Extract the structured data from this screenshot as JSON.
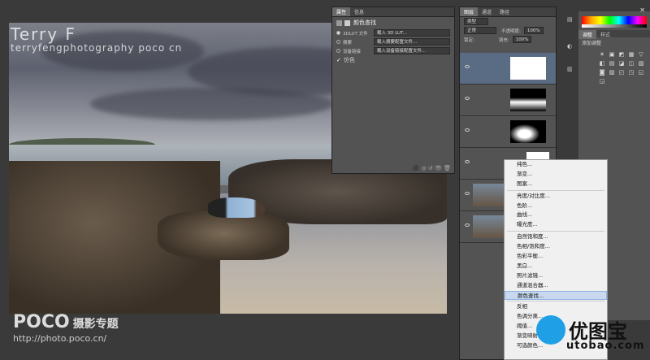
{
  "watermark": {
    "name": "Terry  F",
    "site": "terryfengphotography poco cn"
  },
  "logo": {
    "brand": "POCO",
    "sub": "摄影专题",
    "url": "http://photo.poco.cn/"
  },
  "props_panel": {
    "tabs": [
      "属性",
      "信息"
    ],
    "title": "颜色查找",
    "rows": [
      {
        "label": "3DLUT 文件",
        "value": "载入 3D LUT...",
        "selected": true
      },
      {
        "label": "摘要",
        "value": "载入摘要配置文件...",
        "selected": false
      },
      {
        "label": "设备链接",
        "value": "载入设备链接配置文件...",
        "selected": false
      }
    ],
    "dither_label": "仿色"
  },
  "layers_panel": {
    "tabs": [
      "图层",
      "通道",
      "路径"
    ],
    "kind": "类型",
    "blend": "正常",
    "opacity_label": "不透明度:",
    "opacity": "100%",
    "lock_label": "锁定:",
    "fill_label": "填充:",
    "fill": "100%"
  },
  "right_panel": {
    "tabs": [
      "调整",
      "样式"
    ],
    "title": "添加调整",
    "icons": [
      "☀",
      "▣",
      "◩",
      "▦",
      "▽",
      "◧",
      "▤",
      "◪",
      "◫",
      "▧",
      "◙",
      "▨",
      "◰",
      "◳",
      "◱",
      "◲"
    ]
  },
  "context_menu": {
    "items": [
      {
        "label": "纯色...",
        "hl": false
      },
      {
        "label": "渐变...",
        "hl": false
      },
      {
        "label": "图案...",
        "hl": false
      },
      {
        "sep": true
      },
      {
        "label": "亮度/对比度...",
        "hl": false
      },
      {
        "label": "色阶...",
        "hl": false
      },
      {
        "label": "曲线...",
        "hl": false
      },
      {
        "label": "曝光度...",
        "hl": false
      },
      {
        "sep": true
      },
      {
        "label": "自然饱和度...",
        "hl": false
      },
      {
        "label": "色相/饱和度...",
        "hl": false
      },
      {
        "label": "色彩平衡...",
        "hl": false
      },
      {
        "label": "黑白...",
        "hl": false
      },
      {
        "label": "照片滤镜...",
        "hl": false
      },
      {
        "label": "通道混合器...",
        "hl": false
      },
      {
        "label": "颜色查找...",
        "hl": true
      },
      {
        "sep": true
      },
      {
        "label": "反相",
        "hl": false
      },
      {
        "label": "色调分离...",
        "hl": false
      },
      {
        "label": "阈值...",
        "hl": false
      },
      {
        "label": "渐变映射...",
        "hl": false
      },
      {
        "label": "可选颜色...",
        "hl": false
      }
    ]
  },
  "brand": {
    "cn": "优图宝",
    "url": "utobao.com"
  },
  "colors": {
    "menu_highlight": "#c8d9ef",
    "layer_selected": "#5a6b84",
    "brand_blue": "#1f9fe6"
  }
}
